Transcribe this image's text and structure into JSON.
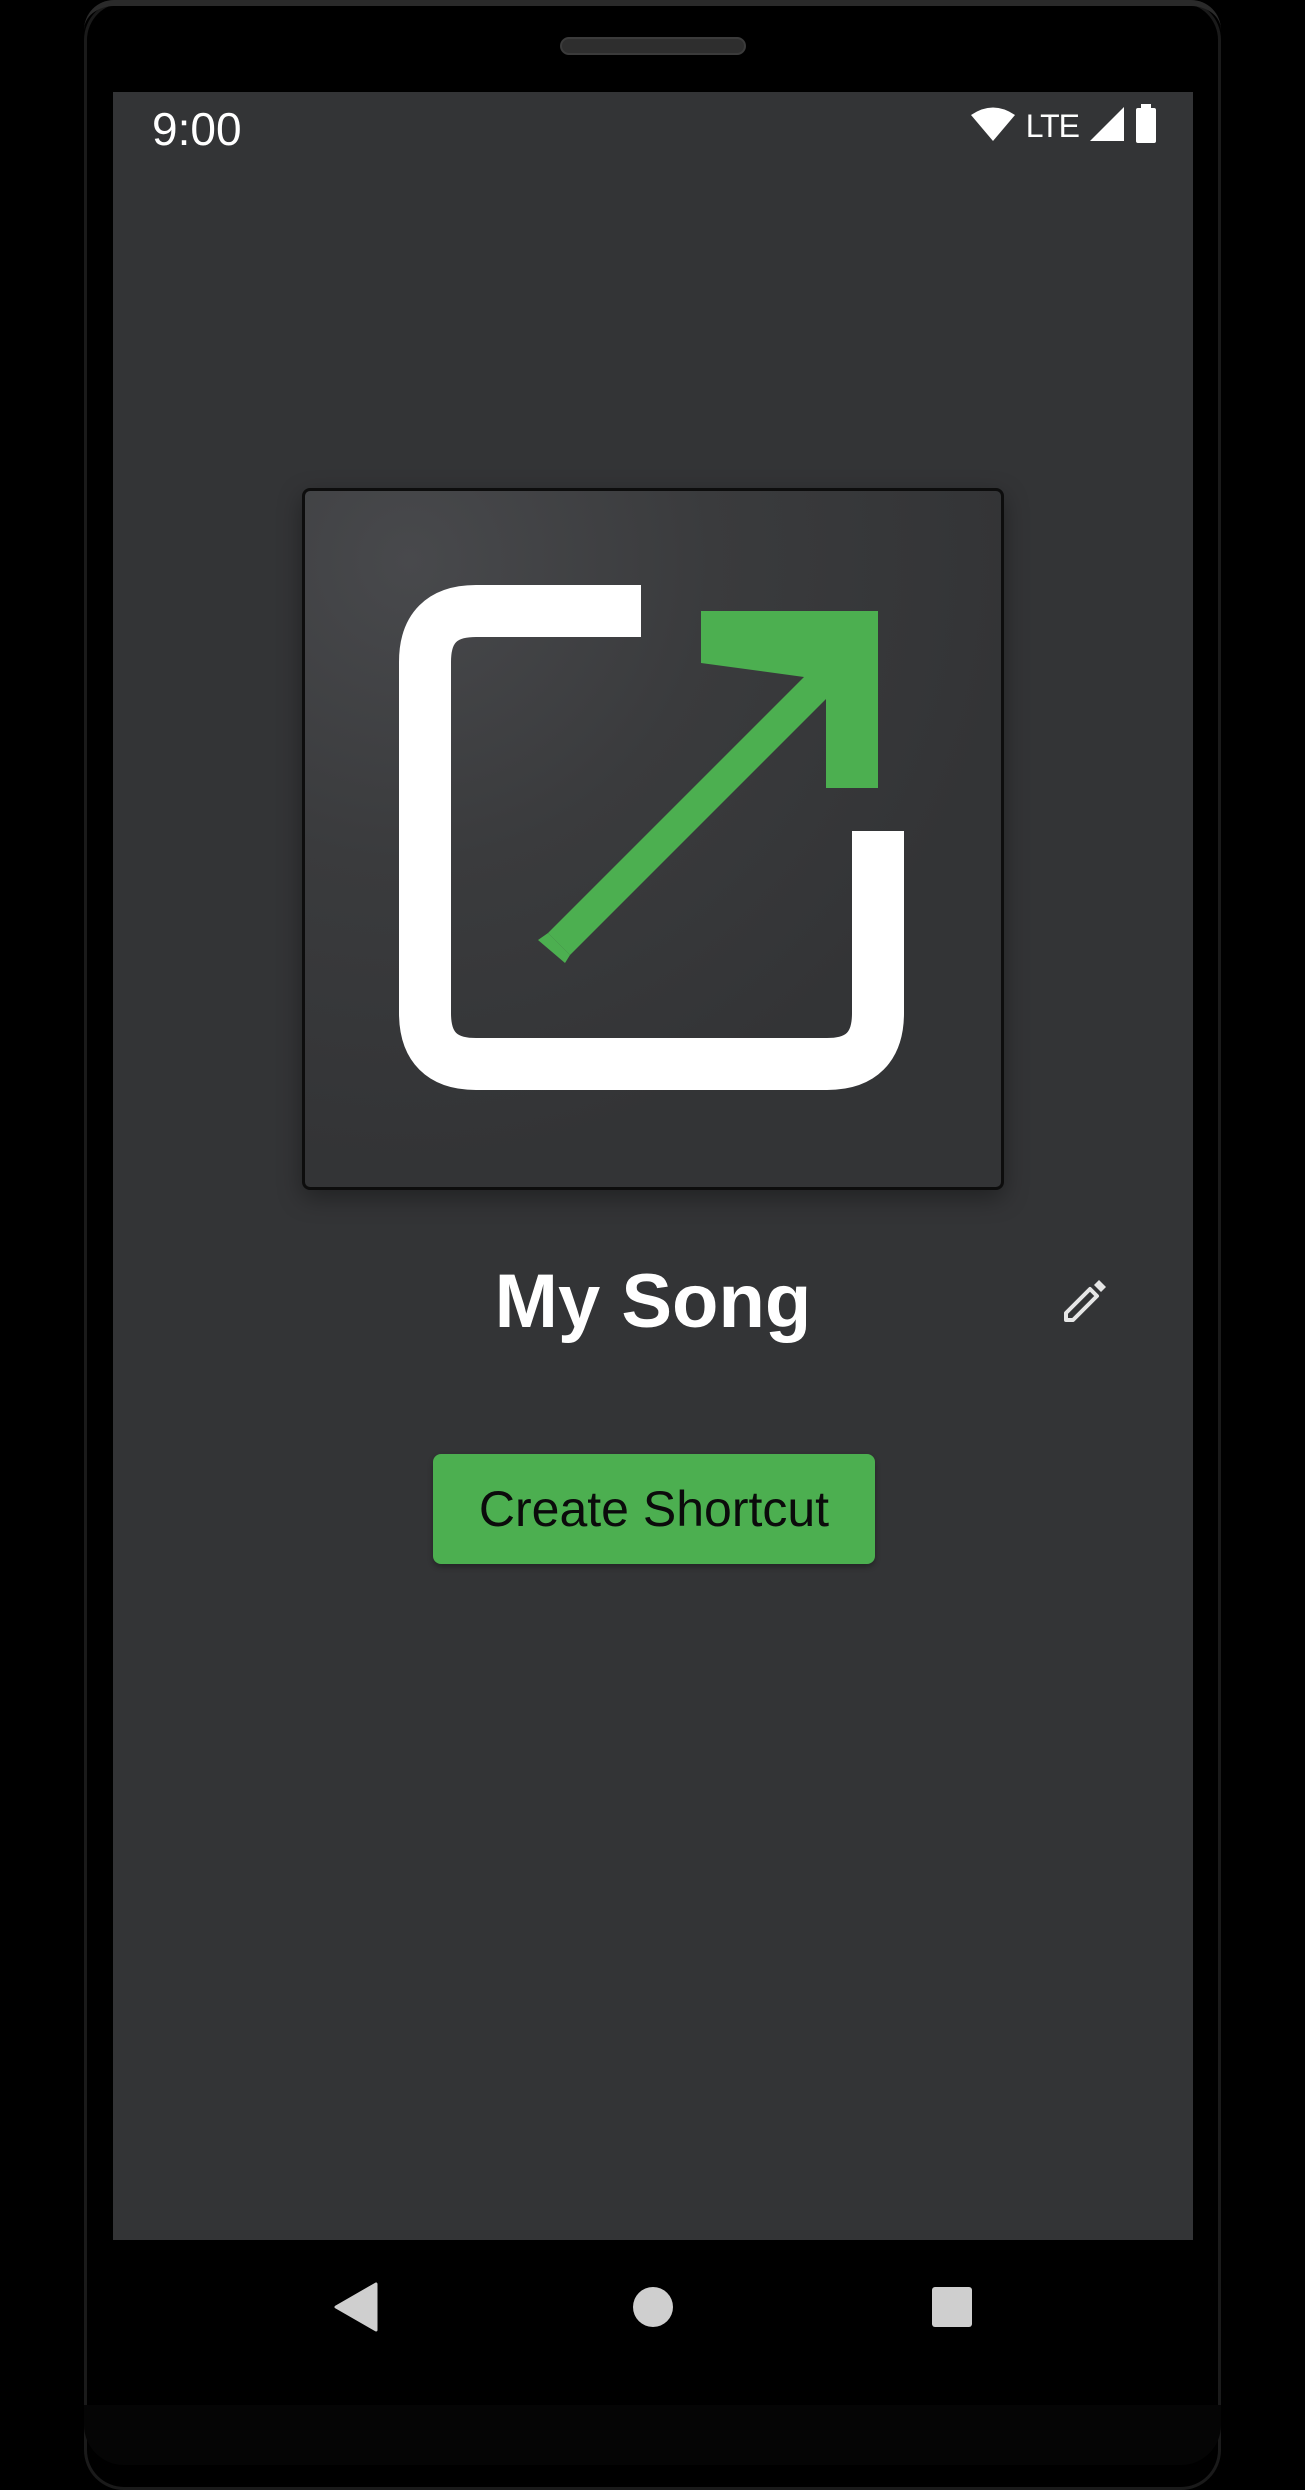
{
  "status_bar": {
    "time": "9:00",
    "network_label": "LTE",
    "icons": [
      "wifi-icon",
      "cell-signal-icon",
      "battery-icon"
    ]
  },
  "shortcut": {
    "preview_icon": "open-in-new-icon",
    "name": "My Song",
    "edit_icon": "pencil-icon",
    "create_label": "Create Shortcut"
  },
  "navigation": {
    "icons": [
      "back-icon",
      "home-icon",
      "recents-icon"
    ]
  },
  "colors": {
    "accent": "#4caf50",
    "screen_background": "#333436",
    "text_primary": "#ffffff",
    "icon_white": "#ffffff"
  }
}
